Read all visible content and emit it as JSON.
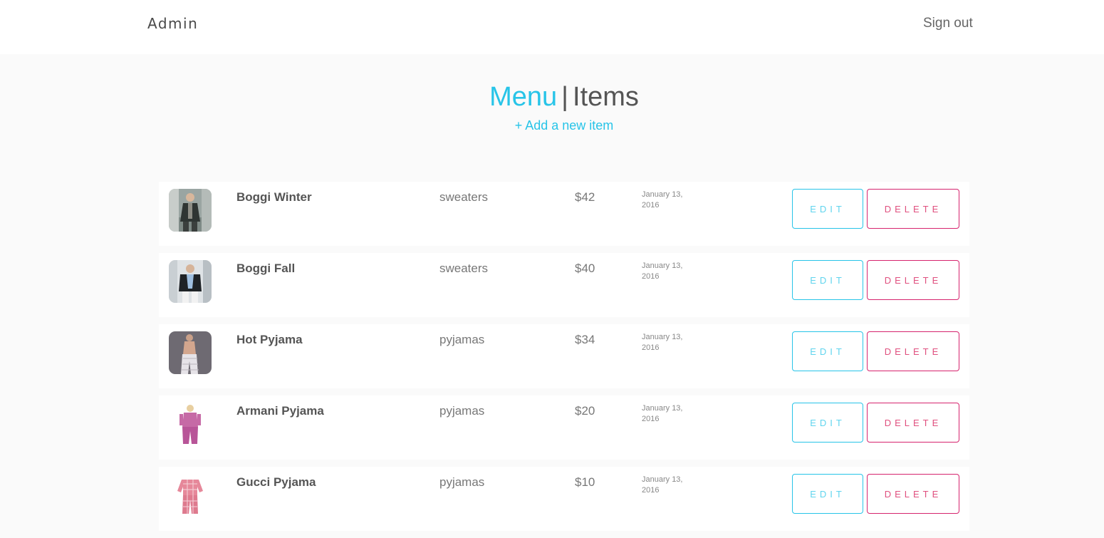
{
  "header": {
    "brand": "Admin",
    "sign_out": "Sign out"
  },
  "page": {
    "title_menu": "Menu",
    "title_separator": "|",
    "title_items": "Items",
    "add_link": "+ Add a new item"
  },
  "buttons": {
    "edit": "EDIT",
    "delete": "DELETE"
  },
  "colors": {
    "accent": "#27c4e8",
    "danger": "#d6246e"
  },
  "items": [
    {
      "name": "Boggi Winter",
      "category": "sweaters",
      "price": "$42",
      "date_line1": "January 13,",
      "date_line2": "2016",
      "thumb": "man-in-coat-street-photo"
    },
    {
      "name": "Boggi Fall",
      "category": "sweaters",
      "price": "$40",
      "date_line1": "January 13,",
      "date_line2": "2016",
      "thumb": "man-in-blazer-photo"
    },
    {
      "name": "Hot Pyjama",
      "category": "pyjamas",
      "price": "$34",
      "date_line1": "January 13,",
      "date_line2": "2016",
      "thumb": "model-in-pyjama-pants-photo"
    },
    {
      "name": "Armani Pyjama",
      "category": "pyjamas",
      "price": "$20",
      "date_line1": "January 13,",
      "date_line2": "2016",
      "thumb": "woman-in-pink-pyjama-photo"
    },
    {
      "name": "Gucci Pyjama",
      "category": "pyjamas",
      "price": "$10",
      "date_line1": "January 13,",
      "date_line2": "2016",
      "thumb": "checked-pyjama-set-photo"
    }
  ]
}
